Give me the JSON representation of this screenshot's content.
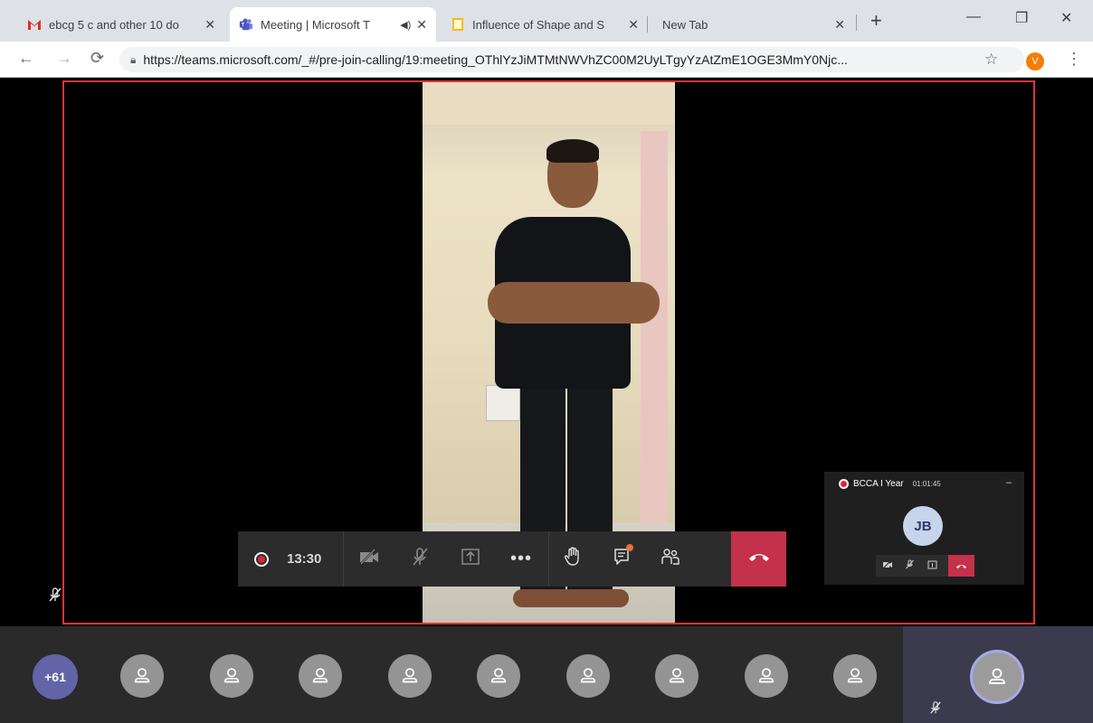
{
  "browser": {
    "tabs": [
      {
        "title": "ebcg 5 c and other 10 do",
        "icon": "gmail-icon",
        "active": false
      },
      {
        "title": "Meeting | Microsoft T",
        "icon": "teams-icon",
        "active": true,
        "audio": true
      },
      {
        "title": "Influence of Shape and S",
        "icon": "doc-icon",
        "active": false
      },
      {
        "title": "New Tab",
        "icon": "",
        "active": false
      }
    ],
    "url": "https://teams.microsoft.com/_#/pre-join-calling/19:meeting_OThlYzJiMTMtNWVhZC00M2UyLTgyYzAtZmE1OGE3MmY0Njc...",
    "profile_initial": "V"
  },
  "meeting": {
    "controls": {
      "timer": "13:30"
    },
    "mini_window": {
      "title": "BCCA I Year",
      "time": "01:01:45",
      "avatar_initials": "JB"
    },
    "participants": {
      "overflow_label": "+61",
      "visible_count": 9
    }
  },
  "colors": {
    "accent": "#6264a7",
    "hangup": "#c4314b",
    "record": "#e0233c",
    "focus_border": "#e03535"
  }
}
